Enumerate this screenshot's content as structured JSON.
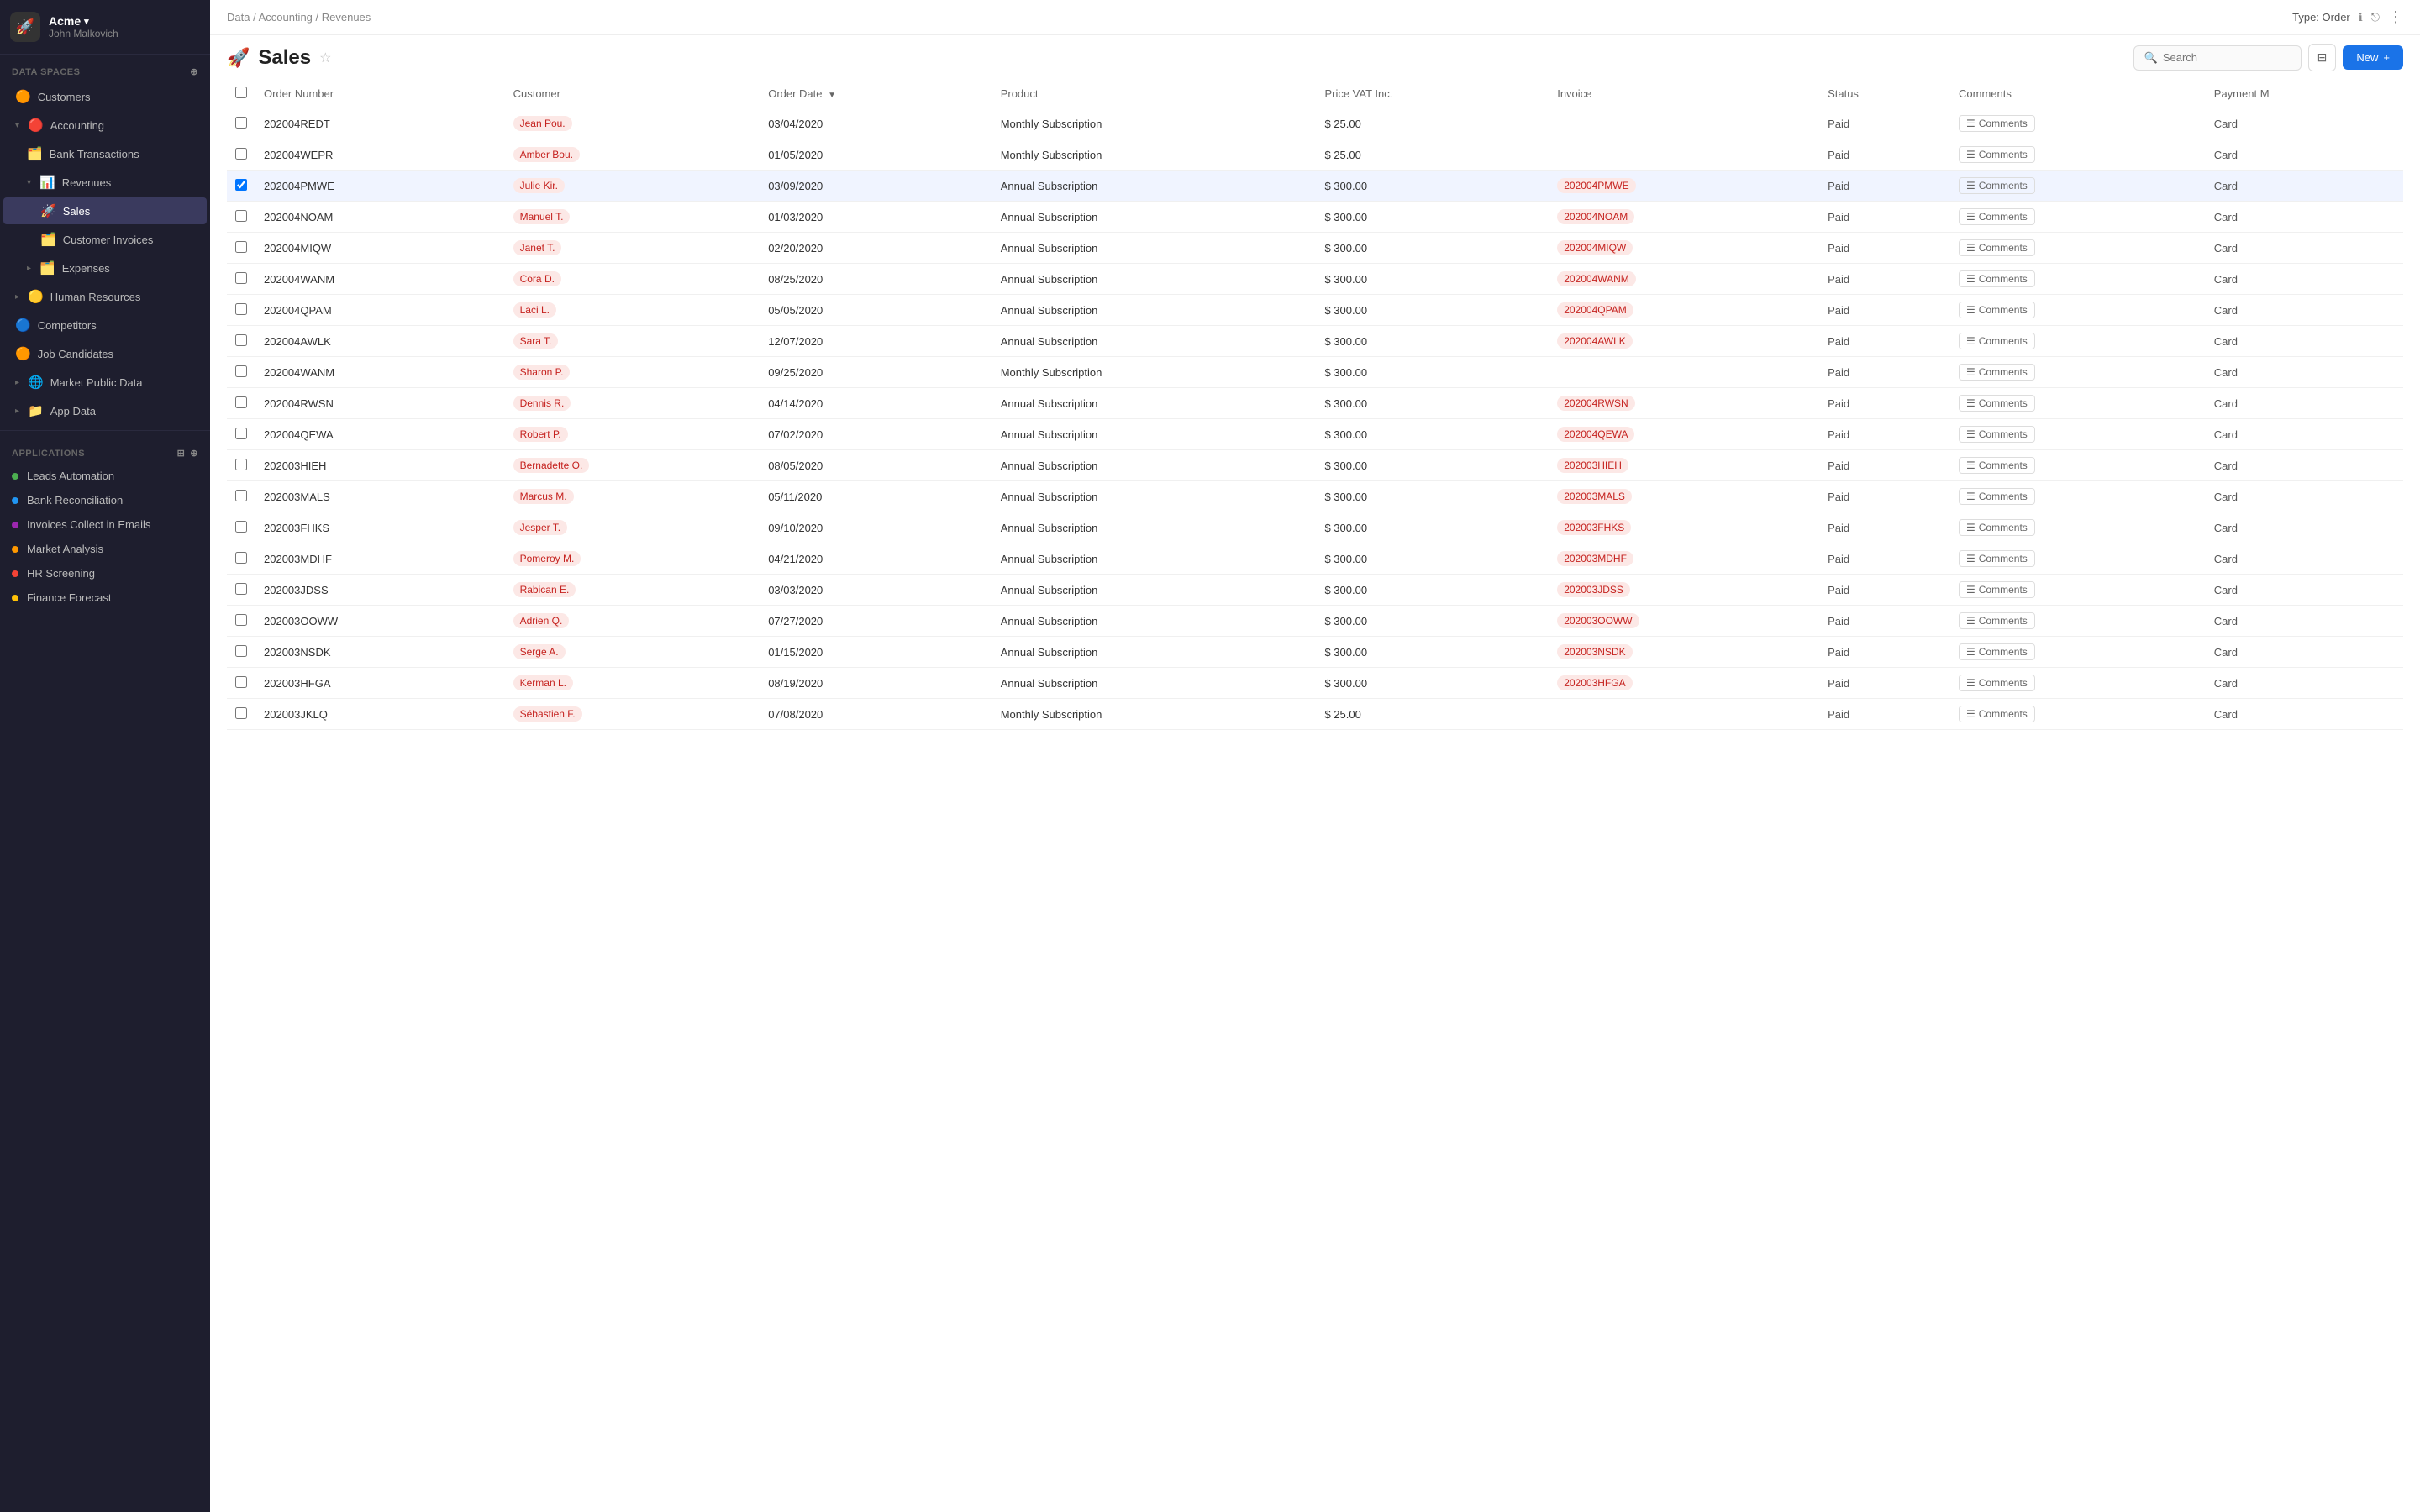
{
  "org": {
    "name": "Acme",
    "user": "John Malkovich",
    "logo": "🚀"
  },
  "sidebar": {
    "data_spaces_label": "Data Spaces",
    "sections": [
      {
        "id": "customers",
        "label": "Customers",
        "icon": "🟠",
        "indent": 0,
        "expandable": false
      },
      {
        "id": "accounting",
        "label": "Accounting",
        "icon": "🔴",
        "indent": 0,
        "expandable": true,
        "expanded": true
      },
      {
        "id": "bank-transactions",
        "label": "Bank Transactions",
        "icon": "🗂️",
        "indent": 1,
        "expandable": false
      },
      {
        "id": "revenues",
        "label": "Revenues",
        "icon": "📊",
        "indent": 1,
        "expandable": true,
        "expanded": true
      },
      {
        "id": "sales",
        "label": "Sales",
        "icon": "🚀",
        "indent": 2,
        "expandable": false,
        "active": true
      },
      {
        "id": "customer-invoices",
        "label": "Customer Invoices",
        "icon": "🗂️",
        "indent": 2,
        "expandable": false
      },
      {
        "id": "expenses",
        "label": "Expenses",
        "icon": "🗂️",
        "indent": 1,
        "expandable": true
      },
      {
        "id": "human-resources",
        "label": "Human Resources",
        "icon": "🟡",
        "indent": 0,
        "expandable": true
      },
      {
        "id": "competitors",
        "label": "Competitors",
        "icon": "🔵",
        "indent": 0,
        "expandable": false
      },
      {
        "id": "job-candidates",
        "label": "Job Candidates",
        "icon": "🟠",
        "indent": 0,
        "expandable": false
      },
      {
        "id": "market-public-data",
        "label": "Market Public Data",
        "icon": "🌐",
        "indent": 0,
        "expandable": true
      },
      {
        "id": "app-data",
        "label": "App Data",
        "icon": "📁",
        "indent": 0,
        "expandable": true
      }
    ],
    "applications_label": "Applications",
    "applications": [
      {
        "id": "leads-automation",
        "label": "Leads Automation",
        "color": "#4caf50"
      },
      {
        "id": "bank-reconciliation",
        "label": "Bank Reconciliation",
        "color": "#2196f3"
      },
      {
        "id": "invoices-collect",
        "label": "Invoices Collect in Emails",
        "color": "#9c27b0"
      },
      {
        "id": "market-analysis",
        "label": "Market Analysis",
        "color": "#ff9800"
      },
      {
        "id": "hr-screening",
        "label": "HR Screening",
        "color": "#f44336"
      },
      {
        "id": "finance-forecast",
        "label": "Finance Forecast",
        "color": "#ffc107"
      }
    ]
  },
  "breadcrumb": "Data / Accounting / Revenues",
  "page": {
    "icon": "🚀",
    "title": "Sales",
    "type_label": "Type: Order"
  },
  "toolbar": {
    "search_placeholder": "Search",
    "new_label": "New"
  },
  "table": {
    "columns": [
      {
        "id": "order-number",
        "label": "Order Number",
        "sortable": false
      },
      {
        "id": "customer",
        "label": "Customer",
        "sortable": false
      },
      {
        "id": "order-date",
        "label": "Order Date",
        "sortable": true
      },
      {
        "id": "product",
        "label": "Product",
        "sortable": false
      },
      {
        "id": "price-vat",
        "label": "Price VAT Inc.",
        "sortable": false
      },
      {
        "id": "invoice",
        "label": "Invoice",
        "sortable": false
      },
      {
        "id": "status",
        "label": "Status",
        "sortable": false
      },
      {
        "id": "comments",
        "label": "Comments",
        "sortable": false
      },
      {
        "id": "payment-m",
        "label": "Payment M",
        "sortable": false
      }
    ],
    "rows": [
      {
        "order": "202004REDT",
        "customer": "Jean Pou.",
        "date": "03/04/2020",
        "product": "Monthly Subscription",
        "price": "$ 25.00",
        "invoice": "",
        "status": "Paid",
        "payment": "Card",
        "selected": false,
        "hasInvoiceTag": false
      },
      {
        "order": "202004WEPR",
        "customer": "Amber Bou.",
        "date": "01/05/2020",
        "product": "Monthly Subscription",
        "price": "$ 25.00",
        "invoice": "",
        "status": "Paid",
        "payment": "Card",
        "selected": false,
        "hasInvoiceTag": false
      },
      {
        "order": "202004PMWE",
        "customer": "Julie Kir.",
        "date": "03/09/2020",
        "product": "Annual Subscription",
        "price": "$ 300.00",
        "invoice": "202004PMWE",
        "status": "Paid",
        "payment": "Card",
        "selected": true,
        "hasInvoiceTag": true
      },
      {
        "order": "202004NOAM",
        "customer": "Manuel T.",
        "date": "01/03/2020",
        "product": "Annual Subscription",
        "price": "$ 300.00",
        "invoice": "202004NOAM",
        "status": "Paid",
        "payment": "Card",
        "selected": false,
        "hasInvoiceTag": true
      },
      {
        "order": "202004MIQW",
        "customer": "Janet T.",
        "date": "02/20/2020",
        "product": "Annual Subscription",
        "price": "$ 300.00",
        "invoice": "202004MIQW",
        "status": "Paid",
        "payment": "Card",
        "selected": false,
        "hasInvoiceTag": true
      },
      {
        "order": "202004WANM",
        "customer": "Cora D.",
        "date": "08/25/2020",
        "product": "Annual Subscription",
        "price": "$ 300.00",
        "invoice": "202004WANM",
        "status": "Paid",
        "payment": "Card",
        "selected": false,
        "hasInvoiceTag": true
      },
      {
        "order": "202004QPAM",
        "customer": "Laci L.",
        "date": "05/05/2020",
        "product": "Annual Subscription",
        "price": "$ 300.00",
        "invoice": "202004QPAM",
        "status": "Paid",
        "payment": "Card",
        "selected": false,
        "hasInvoiceTag": true
      },
      {
        "order": "202004AWLK",
        "customer": "Sara T.",
        "date": "12/07/2020",
        "product": "Annual Subscription",
        "price": "$ 300.00",
        "invoice": "202004AWLK",
        "status": "Paid",
        "payment": "Card",
        "selected": false,
        "hasInvoiceTag": true
      },
      {
        "order": "202004WANM",
        "customer": "Sharon P.",
        "date": "09/25/2020",
        "product": "Monthly Subscription",
        "price": "$ 300.00",
        "invoice": "",
        "status": "Paid",
        "payment": "Card",
        "selected": false,
        "hasInvoiceTag": false
      },
      {
        "order": "202004RWSN",
        "customer": "Dennis R.",
        "date": "04/14/2020",
        "product": "Annual Subscription",
        "price": "$ 300.00",
        "invoice": "202004RWSN",
        "status": "Paid",
        "payment": "Card",
        "selected": false,
        "hasInvoiceTag": true
      },
      {
        "order": "202004QEWA",
        "customer": "Robert P.",
        "date": "07/02/2020",
        "product": "Annual Subscription",
        "price": "$ 300.00",
        "invoice": "202004QEWA",
        "status": "Paid",
        "payment": "Card",
        "selected": false,
        "hasInvoiceTag": true
      },
      {
        "order": "202003HIEH",
        "customer": "Bernadette O.",
        "date": "08/05/2020",
        "product": "Annual Subscription",
        "price": "$ 300.00",
        "invoice": "202003HIEH",
        "status": "Paid",
        "payment": "Card",
        "selected": false,
        "hasInvoiceTag": true
      },
      {
        "order": "202003MALS",
        "customer": "Marcus M.",
        "date": "05/11/2020",
        "product": "Annual Subscription",
        "price": "$ 300.00",
        "invoice": "202003MALS",
        "status": "Paid",
        "payment": "Card",
        "selected": false,
        "hasInvoiceTag": true
      },
      {
        "order": "202003FHKS",
        "customer": "Jesper T.",
        "date": "09/10/2020",
        "product": "Annual Subscription",
        "price": "$ 300.00",
        "invoice": "202003FHKS",
        "status": "Paid",
        "payment": "Card",
        "selected": false,
        "hasInvoiceTag": true
      },
      {
        "order": "202003MDHF",
        "customer": "Pomeroy M.",
        "date": "04/21/2020",
        "product": "Annual Subscription",
        "price": "$ 300.00",
        "invoice": "202003MDHF",
        "status": "Paid",
        "payment": "Card",
        "selected": false,
        "hasInvoiceTag": true
      },
      {
        "order": "202003JDSS",
        "customer": "Rabican E.",
        "date": "03/03/2020",
        "product": "Annual Subscription",
        "price": "$ 300.00",
        "invoice": "202003JDSS",
        "status": "Paid",
        "payment": "Card",
        "selected": false,
        "hasInvoiceTag": true
      },
      {
        "order": "202003OOWW",
        "customer": "Adrien Q.",
        "date": "07/27/2020",
        "product": "Annual Subscription",
        "price": "$ 300.00",
        "invoice": "202003OOWW",
        "status": "Paid",
        "payment": "Card",
        "selected": false,
        "hasInvoiceTag": true
      },
      {
        "order": "202003NSDK",
        "customer": "Serge A.",
        "date": "01/15/2020",
        "product": "Annual Subscription",
        "price": "$ 300.00",
        "invoice": "202003NSDK",
        "status": "Paid",
        "payment": "Card",
        "selected": false,
        "hasInvoiceTag": true
      },
      {
        "order": "202003HFGA",
        "customer": "Kerman L.",
        "date": "08/19/2020",
        "product": "Annual Subscription",
        "price": "$ 300.00",
        "invoice": "202003HFGA",
        "status": "Paid",
        "payment": "Card",
        "selected": false,
        "hasInvoiceTag": true
      },
      {
        "order": "202003JKLQ",
        "customer": "Sébastien F.",
        "date": "07/08/2020",
        "product": "Monthly Subscription",
        "price": "$ 25.00",
        "invoice": "",
        "status": "Paid",
        "payment": "Card",
        "selected": false,
        "hasInvoiceTag": false
      }
    ]
  }
}
